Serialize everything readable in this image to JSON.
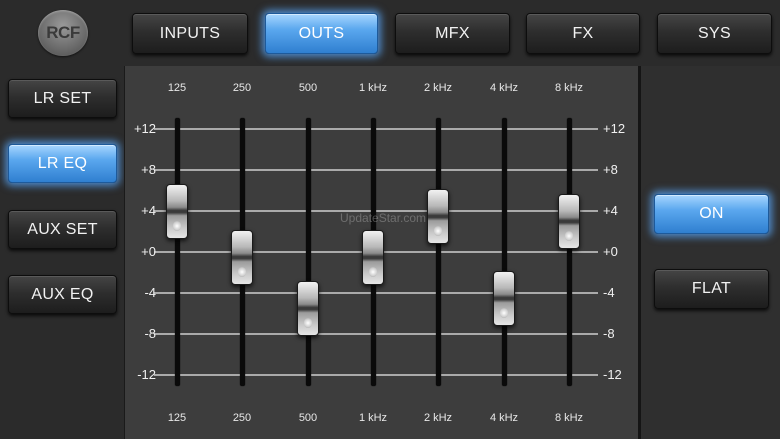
{
  "logo": {
    "text": "RCF"
  },
  "tabs": [
    {
      "label": "INPUTS",
      "active": false
    },
    {
      "label": "OUTS",
      "active": true
    },
    {
      "label": "MFX",
      "active": false
    },
    {
      "label": "FX",
      "active": false
    },
    {
      "label": "SYS",
      "active": false
    }
  ],
  "sidebar": {
    "items": [
      {
        "label": "LR SET",
        "active": false
      },
      {
        "label": "LR EQ",
        "active": true
      },
      {
        "label": "AUX SET",
        "active": false
      },
      {
        "label": "AUX EQ",
        "active": false
      }
    ]
  },
  "eq": {
    "db_scale": [
      "+12",
      "+8",
      "+4",
      "+0",
      "-4",
      "-8",
      "-12"
    ],
    "bands": [
      {
        "freq": "125",
        "gain_db": 4
      },
      {
        "freq": "250",
        "gain_db": -0.5
      },
      {
        "freq": "500",
        "gain_db": -5.5
      },
      {
        "freq": "1 kHz",
        "gain_db": -0.5
      },
      {
        "freq": "2 kHz",
        "gain_db": 3.5
      },
      {
        "freq": "4 kHz",
        "gain_db": -4.5
      },
      {
        "freq": "8 kHz",
        "gain_db": 3
      }
    ]
  },
  "controls": {
    "on_label": "ON",
    "on_active": true,
    "flat_label": "FLAT"
  },
  "watermark": "UpdateStar.com",
  "colors": {
    "accent": "#5aa7ee",
    "panel": "#3d3d3d",
    "background": "#2b2b2b"
  }
}
